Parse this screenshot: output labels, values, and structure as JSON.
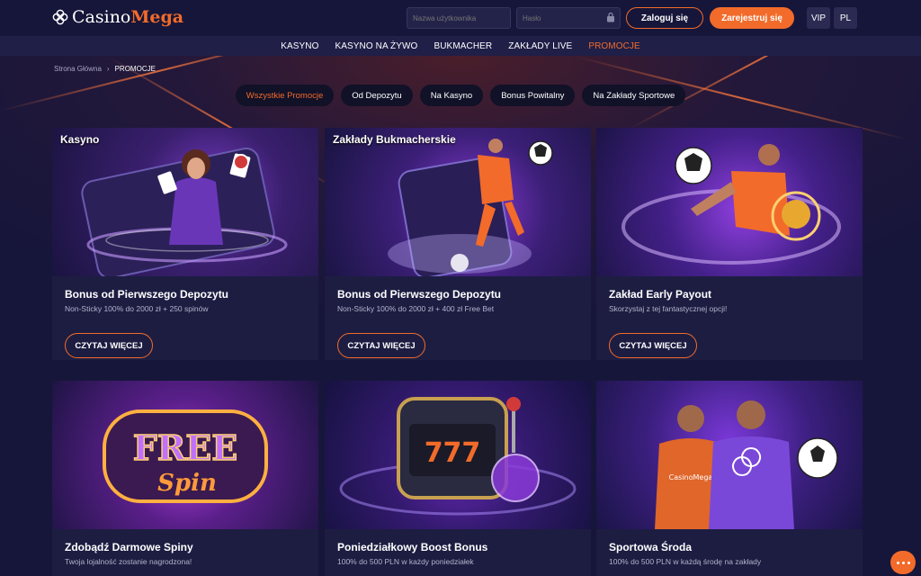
{
  "header": {
    "logo_part1": "Casino",
    "logo_part2": "Mega",
    "username_placeholder": "Nazwa użytkownika",
    "password_placeholder": "Hasło",
    "login_label": "Zaloguj się",
    "register_label": "Zarejestruj się",
    "vip_label": "VIP",
    "lang_label": "PL"
  },
  "nav": {
    "items": [
      "KASYNO",
      "KASYNO NA ŻYWO",
      "BUKMACHER",
      "ZAKŁADY LIVE",
      "PROMOCJE"
    ],
    "active": "PROMOCJE"
  },
  "breadcrumb": {
    "home": "Strona Główna",
    "separator": "›",
    "current": "PROMOCJE"
  },
  "filters": {
    "items": [
      "Wszystkie Promocje",
      "Od Depozytu",
      "Na Kasyno",
      "Bonus Powitalny",
      "Na Zakłady Sportowe"
    ],
    "active": "Wszystkie Promocje"
  },
  "cards": [
    {
      "tag": "Kasyno",
      "title": "Bonus od Pierwszego Depozytu",
      "subtitle": "Non-Sticky 100% do 2000 zł + 250 spinów",
      "button": "CZYTAJ WIĘCEJ"
    },
    {
      "tag": "Zakłady Bukmacherskie",
      "title": "Bonus od Pierwszego Depozytu",
      "subtitle": "Non-Sticky 100% do 2000 zł + 400 zł Free Bet",
      "button": "CZYTAJ WIĘCEJ"
    },
    {
      "tag": "",
      "title": "Zakład Early Payout",
      "subtitle": "Skorzystaj z tej fantastycznej opcji!",
      "button": "CZYTAJ WIĘCEJ"
    },
    {
      "tag": "",
      "title": "Zdobądź Darmowe Spiny",
      "subtitle": "Twoja lojalność zostanie nagrodzona!",
      "button": "",
      "art_text": "FREE",
      "art_text2": "Spin"
    },
    {
      "tag": "",
      "title": "Poniedziałkowy Boost Bonus",
      "subtitle": "100% do 500 PLN w każdy poniedziałek",
      "button": "",
      "art_text": "777"
    },
    {
      "tag": "",
      "title": "Sportowa Środa",
      "subtitle": "100% do 500 PLN w każdą środę na zakłady",
      "button": "",
      "art_text": "CasinoMega"
    }
  ],
  "colors": {
    "accent": "#f26b2a",
    "background": "#14142e",
    "card": "#1d1d42",
    "nav": "#1f1f48"
  }
}
